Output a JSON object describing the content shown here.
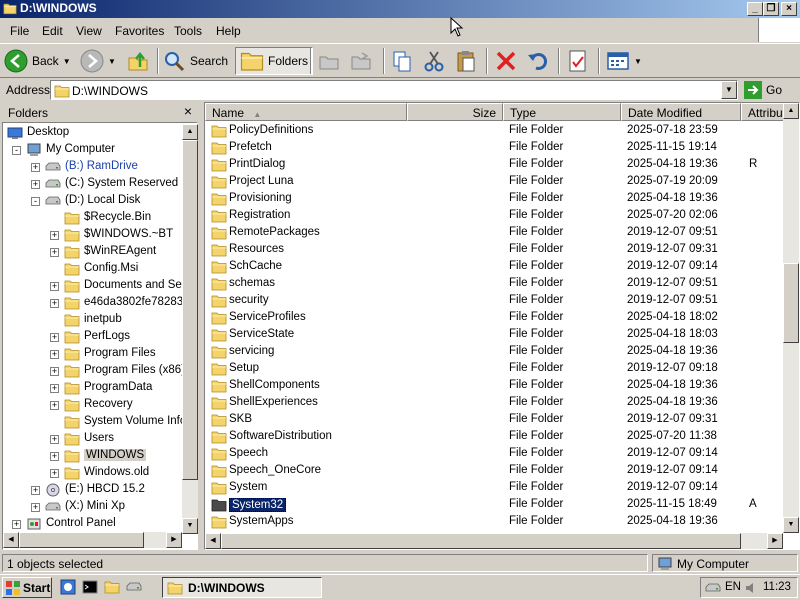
{
  "window": {
    "title": "D:\\WINDOWS"
  },
  "menu": [
    "File",
    "Edit",
    "View",
    "Favorites",
    "Tools",
    "Help"
  ],
  "toolbar": {
    "back": "Back",
    "search": "Search",
    "folders": "Folders"
  },
  "address": {
    "label": "Address",
    "value": "D:\\WINDOWS",
    "go": "Go"
  },
  "folders_pane": {
    "title": "Folders",
    "items": [
      {
        "label": "Desktop"
      },
      {
        "label": "My Computer"
      },
      {
        "label": "(B:) RamDrive"
      },
      {
        "label": "(C:) System Reserved"
      },
      {
        "label": "(D:) Local Disk"
      },
      {
        "label": "$Recycle.Bin"
      },
      {
        "label": "$WINDOWS.~BT"
      },
      {
        "label": "$WinREAgent"
      },
      {
        "label": "Config.Msi"
      },
      {
        "label": "Documents and Setti"
      },
      {
        "label": "e46da3802fe782836"
      },
      {
        "label": "inetpub"
      },
      {
        "label": "PerfLogs"
      },
      {
        "label": "Program Files"
      },
      {
        "label": "Program Files (x86)"
      },
      {
        "label": "ProgramData"
      },
      {
        "label": "Recovery"
      },
      {
        "label": "System Volume Inforr"
      },
      {
        "label": "Users"
      },
      {
        "label": "WINDOWS"
      },
      {
        "label": "Windows.old"
      },
      {
        "label": "(E:) HBCD 15.2"
      },
      {
        "label": "(X:) Mini Xp"
      },
      {
        "label": "Control Panel"
      }
    ]
  },
  "filelist": {
    "columns": [
      "Name",
      "Size",
      "Type",
      "Date Modified",
      "Attribut"
    ],
    "rows": [
      {
        "name": "PolicyDefinitions",
        "type": "File Folder",
        "date": "2025-07-18 23:59",
        "attr": ""
      },
      {
        "name": "Prefetch",
        "type": "File Folder",
        "date": "2025-11-15 19:14",
        "attr": ""
      },
      {
        "name": "PrintDialog",
        "type": "File Folder",
        "date": "2025-04-18 19:36",
        "attr": "R"
      },
      {
        "name": "Project Luna",
        "type": "File Folder",
        "date": "2025-07-19 20:09",
        "attr": ""
      },
      {
        "name": "Provisioning",
        "type": "File Folder",
        "date": "2025-04-18 19:36",
        "attr": ""
      },
      {
        "name": "Registration",
        "type": "File Folder",
        "date": "2025-07-20 02:06",
        "attr": ""
      },
      {
        "name": "RemotePackages",
        "type": "File Folder",
        "date": "2019-12-07 09:51",
        "attr": ""
      },
      {
        "name": "Resources",
        "type": "File Folder",
        "date": "2019-12-07 09:31",
        "attr": ""
      },
      {
        "name": "SchCache",
        "type": "File Folder",
        "date": "2019-12-07 09:14",
        "attr": ""
      },
      {
        "name": "schemas",
        "type": "File Folder",
        "date": "2019-12-07 09:51",
        "attr": ""
      },
      {
        "name": "security",
        "type": "File Folder",
        "date": "2019-12-07 09:51",
        "attr": ""
      },
      {
        "name": "ServiceProfiles",
        "type": "File Folder",
        "date": "2025-04-18 18:02",
        "attr": ""
      },
      {
        "name": "ServiceState",
        "type": "File Folder",
        "date": "2025-04-18 18:03",
        "attr": ""
      },
      {
        "name": "servicing",
        "type": "File Folder",
        "date": "2025-04-18 19:36",
        "attr": ""
      },
      {
        "name": "Setup",
        "type": "File Folder",
        "date": "2019-12-07 09:18",
        "attr": ""
      },
      {
        "name": "ShellComponents",
        "type": "File Folder",
        "date": "2025-04-18 19:36",
        "attr": ""
      },
      {
        "name": "ShellExperiences",
        "type": "File Folder",
        "date": "2025-04-18 19:36",
        "attr": ""
      },
      {
        "name": "SKB",
        "type": "File Folder",
        "date": "2019-12-07 09:31",
        "attr": ""
      },
      {
        "name": "SoftwareDistribution",
        "type": "File Folder",
        "date": "2025-07-20 11:38",
        "attr": ""
      },
      {
        "name": "Speech",
        "type": "File Folder",
        "date": "2019-12-07 09:14",
        "attr": ""
      },
      {
        "name": "Speech_OneCore",
        "type": "File Folder",
        "date": "2019-12-07 09:14",
        "attr": ""
      },
      {
        "name": "System",
        "type": "File Folder",
        "date": "2019-12-07 09:14",
        "attr": ""
      },
      {
        "name": "System32",
        "type": "File Folder",
        "date": "2025-11-15 18:49",
        "attr": "A"
      },
      {
        "name": "SystemApps",
        "type": "File Folder",
        "date": "2025-04-18 19:36",
        "attr": ""
      }
    ]
  },
  "status": {
    "selection": "1 objects selected",
    "zone": "My Computer"
  },
  "taskbar": {
    "start": "Start",
    "task": "D:\\WINDOWS",
    "lang": "EN",
    "clock": "11:23"
  },
  "colors": {
    "title_start": "#0a246a",
    "title_end": "#a6caf0",
    "face": "#d4d0c8",
    "folder": "#f5d36b",
    "select": "#0a246a"
  }
}
